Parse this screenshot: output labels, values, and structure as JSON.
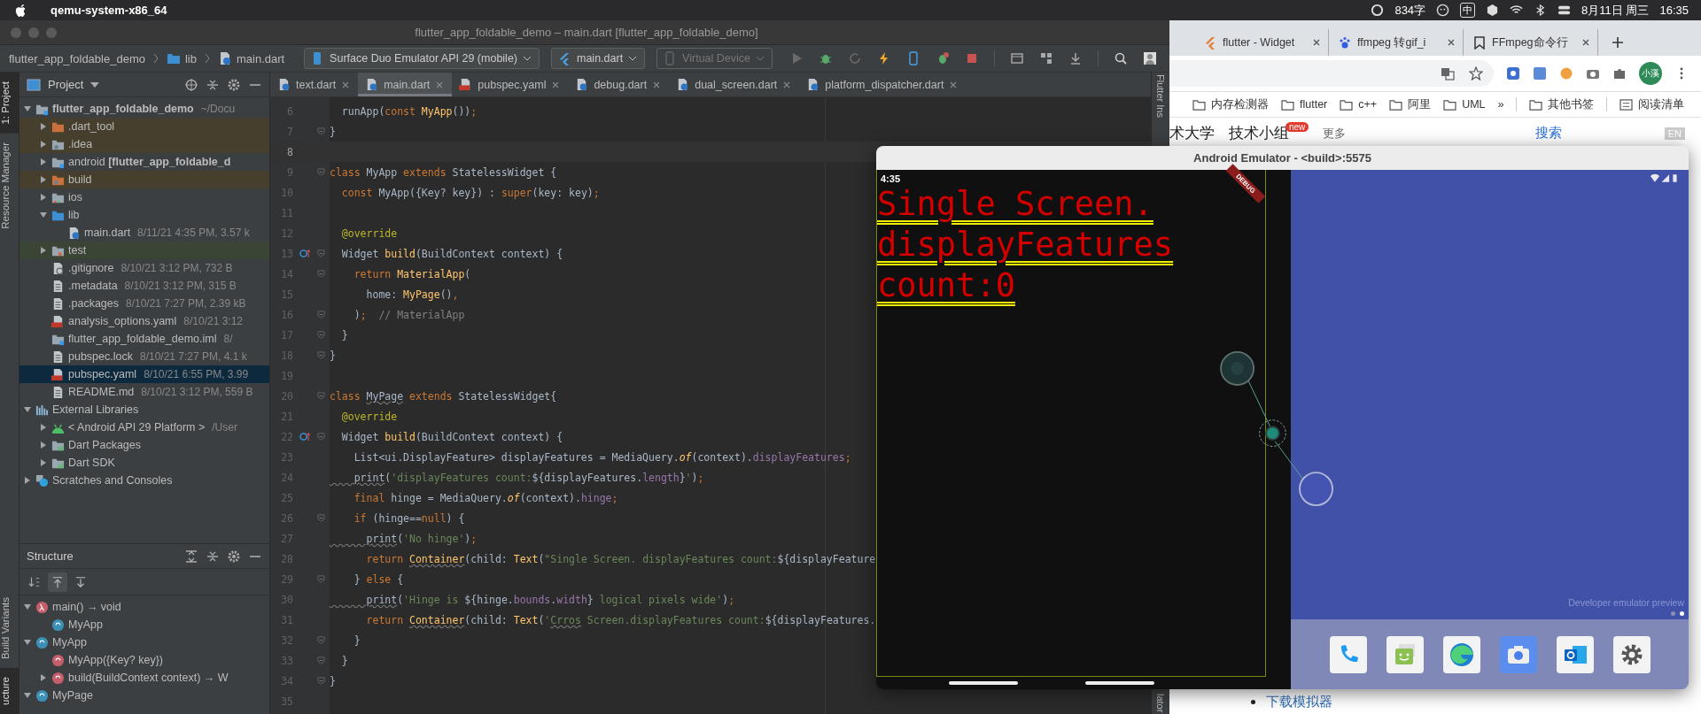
{
  "menubar": {
    "app": "qemu-system-x86_64",
    "input_count": "834字",
    "input_method": "中",
    "date": "8月11日 周三",
    "time": "16:35"
  },
  "ide": {
    "title": "flutter_app_foldable_demo – main.dart [flutter_app_foldable_demo]",
    "breadcrumb": [
      "flutter_app_foldable_demo",
      "lib",
      "main.dart"
    ],
    "device_selector": "Surface Duo Emulator API 29 (mobile)",
    "run_config": "main.dart",
    "target_selector": "Virtual Device",
    "left_strip": [
      {
        "label": "1: Project",
        "selected": true
      },
      {
        "label": "Resource Manager",
        "selected": false
      },
      {
        "label": "Build Variants",
        "selected": false
      },
      {
        "label": "ucture",
        "selected": true
      }
    ],
    "right_strip": [
      "Flutter Ins",
      "lator"
    ],
    "project": {
      "title": "Project",
      "tree": [
        {
          "name": "flutter_app_foldable_demo",
          "detail": "~/Docu",
          "kind": "module-root",
          "expanded": true,
          "selected": false,
          "children": [
            {
              "name": ".dart_tool",
              "kind": "folder-orange",
              "expanded": false,
              "selected": false,
              "color": "#463f2e"
            },
            {
              "name": ".idea",
              "kind": "folder-gear",
              "expanded": false,
              "selected": false,
              "color": "#463f2e"
            },
            {
              "name": "android **[flutter_app_foldable_d**",
              "kind": "module",
              "expanded": false,
              "selected": false
            },
            {
              "name": "build",
              "kind": "folder-orange-gear",
              "expanded": false,
              "selected": false,
              "color": "#463f2e"
            },
            {
              "name": "ios",
              "kind": "folder-ios",
              "expanded": false,
              "selected": false
            },
            {
              "name": "lib",
              "kind": "folder-blue",
              "expanded": true,
              "selected": false,
              "children": [
                {
                  "name": "main.dart",
                  "detail": "8/11/21 4:35 PM, 3.57 k",
                  "kind": "dart",
                  "selected": false
                }
              ]
            },
            {
              "name": "test",
              "kind": "folder-test",
              "expanded": false,
              "selected": false,
              "color": "#3b4536"
            },
            {
              "name": ".gitignore",
              "detail": "8/10/21 3:12 PM, 732 B",
              "kind": "file-ignore",
              "selected": false
            },
            {
              "name": ".metadata",
              "detail": "8/10/21 3:12 PM, 315 B",
              "kind": "file",
              "selected": false
            },
            {
              "name": ".packages",
              "detail": "8/10/21 7:27 PM, 2.39 kB",
              "kind": "file",
              "selected": false
            },
            {
              "name": "analysis_options.yaml",
              "detail": "8/10/21 3:12",
              "kind": "yaml",
              "selected": false
            },
            {
              "name": "flutter_app_foldable_demo.iml",
              "detail": "8/",
              "kind": "module",
              "selected": false
            },
            {
              "name": "pubspec.lock",
              "detail": "8/10/21 7:27 PM, 4.1 k",
              "kind": "file",
              "selected": false
            },
            {
              "name": "pubspec.yaml",
              "detail": "8/10/21 6:55 PM, 3.99",
              "kind": "yaml",
              "selected": true
            },
            {
              "name": "README.md",
              "detail": "8/10/21 3:12 PM, 559 B",
              "kind": "file",
              "selected": false
            }
          ]
        },
        {
          "name": "External Libraries",
          "kind": "libraries",
          "expanded": true,
          "selected": false,
          "children": [
            {
              "name": "< Android API 29 Platform >",
              "detail": "/User",
              "kind": "android",
              "expanded": false,
              "selected": false
            },
            {
              "name": "Dart Packages",
              "kind": "library",
              "expanded": false,
              "selected": false
            },
            {
              "name": "Dart SDK",
              "kind": "library",
              "expanded": false,
              "selected": false
            }
          ]
        },
        {
          "name": "Scratches and Consoles",
          "kind": "scratches",
          "expanded": false,
          "selected": false
        }
      ]
    },
    "structure": {
      "title": "Structure",
      "tools": [
        {
          "kind": "sort",
          "selected": false
        },
        {
          "kind": "up",
          "selected": true
        },
        {
          "kind": "down",
          "selected": false
        }
      ],
      "tree": [
        {
          "name": "main() → void",
          "kind": "function",
          "expanded": true,
          "selected": false,
          "children": [
            {
              "name": "MyApp",
              "kind": "class",
              "selected": false
            }
          ]
        },
        {
          "name": "MyApp",
          "kind": "class",
          "expanded": true,
          "selected": false,
          "children": [
            {
              "name": "MyApp({Key? key})",
              "kind": "method",
              "selected": false
            },
            {
              "name": "build(BuildContext context) → W",
              "kind": "method",
              "expanded": false,
              "selected": false
            }
          ]
        },
        {
          "name": "MyPage",
          "kind": "class",
          "expanded": true,
          "selected": false
        }
      ]
    },
    "tabs": [
      {
        "label": "text.dart",
        "kind": "dart",
        "selected": false
      },
      {
        "label": "main.dart",
        "kind": "dart",
        "selected": true
      },
      {
        "label": "pubspec.yaml",
        "kind": "yaml",
        "selected": false
      },
      {
        "label": "debug.dart",
        "kind": "dart",
        "selected": false
      },
      {
        "label": "dual_screen.dart",
        "kind": "dart",
        "selected": false
      },
      {
        "label": "platform_dispatcher.dart",
        "kind": "dart",
        "selected": false
      }
    ],
    "lines": [
      {
        "number": "6",
        "current": false,
        "fold": false,
        "override": false,
        "tokens": [
          {
            "kind": "plain",
            "text": "  runApp("
          },
          {
            "kind": "keyword",
            "text": "const "
          },
          {
            "kind": "call",
            "text": "MyApp"
          },
          {
            "kind": "plain",
            "text": "())"
          },
          {
            "kind": "keyword",
            "text": ";"
          }
        ]
      },
      {
        "number": "7",
        "current": false,
        "fold": true,
        "override": false,
        "tokens": [
          {
            "kind": "plain",
            "text": "}"
          }
        ]
      },
      {
        "number": "8",
        "current": true,
        "fold": false,
        "override": false
      },
      {
        "number": "9",
        "current": false,
        "fold": true,
        "override": false,
        "tokens": [
          {
            "kind": "keyword",
            "text": "class "
          },
          {
            "kind": "plain",
            "text": "MyApp "
          },
          {
            "kind": "keyword",
            "text": "extends "
          },
          {
            "kind": "plain",
            "text": "StatelessWidget {"
          }
        ]
      },
      {
        "number": "10",
        "current": false,
        "fold": false,
        "override": false,
        "tokens": [
          {
            "kind": "keyword",
            "text": "  const "
          },
          {
            "kind": "plain",
            "text": "MyApp({Key? key}) : "
          },
          {
            "kind": "keyword",
            "text": "super"
          },
          {
            "kind": "plain",
            "text": "(key: key)"
          },
          {
            "kind": "keyword",
            "text": ";"
          }
        ]
      },
      {
        "number": "11",
        "current": false,
        "fold": false,
        "override": false
      },
      {
        "number": "12",
        "current": false,
        "fold": false,
        "override": false,
        "tokens": [
          {
            "kind": "annotation",
            "text": "  @override"
          }
        ]
      },
      {
        "number": "13",
        "current": false,
        "fold": true,
        "override": true,
        "tokens": [
          {
            "kind": "plain",
            "text": "  Widget "
          },
          {
            "kind": "call",
            "text": "build"
          },
          {
            "kind": "plain",
            "text": "(BuildContext context) {"
          }
        ]
      },
      {
        "number": "14",
        "current": false,
        "fold": true,
        "override": false,
        "tokens": [
          {
            "kind": "keyword",
            "text": "    return "
          },
          {
            "kind": "call",
            "text": "MaterialApp"
          },
          {
            "kind": "plain",
            "text": "("
          }
        ]
      },
      {
        "number": "15",
        "current": false,
        "fold": false,
        "override": false,
        "tokens": [
          {
            "kind": "plain",
            "text": "      home: "
          },
          {
            "kind": "call",
            "text": "MyPage"
          },
          {
            "kind": "plain",
            "text": "()"
          },
          {
            "kind": "keyword",
            "text": ","
          }
        ]
      },
      {
        "number": "16",
        "current": false,
        "fold": true,
        "override": false,
        "tokens": [
          {
            "kind": "plain",
            "text": "    )"
          },
          {
            "kind": "keyword",
            "text": ";"
          },
          {
            "kind": "comment",
            "text": "  // MaterialApp"
          }
        ]
      },
      {
        "number": "17",
        "current": false,
        "fold": true,
        "override": false,
        "tokens": [
          {
            "kind": "plain",
            "text": "  }"
          }
        ]
      },
      {
        "number": "18",
        "current": false,
        "fold": true,
        "override": false,
        "tokens": [
          {
            "kind": "plain",
            "text": "}"
          }
        ]
      },
      {
        "number": "19",
        "current": false,
        "fold": false,
        "override": false
      },
      {
        "number": "20",
        "current": false,
        "fold": true,
        "override": false,
        "tokens": [
          {
            "kind": "keyword",
            "text": "class "
          },
          {
            "kind": "warn",
            "text": "MyPage"
          },
          {
            "kind": "keyword",
            "text": " extends "
          },
          {
            "kind": "plain",
            "text": "StatelessWidget{"
          }
        ]
      },
      {
        "number": "21",
        "current": false,
        "fold": false,
        "override": false,
        "tokens": [
          {
            "kind": "annotation",
            "text": "  @override"
          }
        ]
      },
      {
        "number": "22",
        "current": false,
        "fold": true,
        "override": true,
        "tokens": [
          {
            "kind": "plain",
            "text": "  Widget "
          },
          {
            "kind": "call",
            "text": "build"
          },
          {
            "kind": "plain",
            "text": "(BuildContext context) {"
          }
        ]
      },
      {
        "number": "23",
        "current": false,
        "fold": false,
        "override": false,
        "tokens": [
          {
            "kind": "plain",
            "text": "    List<ui.DisplayFeature> displayFeatures = MediaQuery."
          },
          {
            "kind": "static",
            "text": "of"
          },
          {
            "kind": "plain",
            "text": "(context)."
          },
          {
            "kind": "field",
            "text": "displayFeatures"
          },
          {
            "kind": "keyword",
            "text": ";"
          }
        ]
      },
      {
        "number": "24",
        "current": false,
        "fold": false,
        "override": false,
        "tokens": [
          {
            "kind": "warn",
            "text": "    print"
          },
          {
            "kind": "plain",
            "text": "("
          },
          {
            "kind": "string",
            "text": "'displayFeatures count:"
          },
          {
            "kind": "plain",
            "text": "${displayFeatures."
          },
          {
            "kind": "field",
            "text": "length"
          },
          {
            "kind": "plain",
            "text": "}"
          },
          {
            "kind": "string",
            "text": "'"
          },
          {
            "kind": "plain",
            "text": ")"
          },
          {
            "kind": "keyword",
            "text": ";"
          }
        ]
      },
      {
        "number": "25",
        "current": false,
        "fold": false,
        "override": false,
        "tokens": [
          {
            "kind": "keyword",
            "text": "    final "
          },
          {
            "kind": "plain",
            "text": "hinge = MediaQuery."
          },
          {
            "kind": "static",
            "text": "of"
          },
          {
            "kind": "plain",
            "text": "(context)."
          },
          {
            "kind": "field",
            "text": "hinge"
          },
          {
            "kind": "keyword",
            "text": ";"
          }
        ]
      },
      {
        "number": "26",
        "current": false,
        "fold": true,
        "override": false,
        "tokens": [
          {
            "kind": "keyword",
            "text": "    if "
          },
          {
            "kind": "plain",
            "text": "(hinge=="
          },
          {
            "kind": "keyword",
            "text": "null"
          },
          {
            "kind": "plain",
            "text": ") {"
          }
        ]
      },
      {
        "number": "27",
        "current": false,
        "fold": false,
        "override": false,
        "tokens": [
          {
            "kind": "warn",
            "text": "      print"
          },
          {
            "kind": "plain",
            "text": "("
          },
          {
            "kind": "string",
            "text": "'No hinge'"
          },
          {
            "kind": "plain",
            "text": ")"
          },
          {
            "kind": "keyword",
            "text": ";"
          }
        ]
      },
      {
        "number": "28",
        "current": false,
        "fold": false,
        "override": false,
        "tokens": [
          {
            "kind": "keyword",
            "text": "      return "
          },
          {
            "kind": "warn-call",
            "text": "Container"
          },
          {
            "kind": "plain",
            "text": "(child: "
          },
          {
            "kind": "call",
            "text": "Text"
          },
          {
            "kind": "plain",
            "text": "("
          },
          {
            "kind": "string",
            "text": "\"Single Screen. displayFeatures count:"
          },
          {
            "kind": "plain",
            "text": "${displayFeature"
          }
        ]
      },
      {
        "number": "29",
        "current": false,
        "fold": true,
        "override": false,
        "tokens": [
          {
            "kind": "plain",
            "text": "    } "
          },
          {
            "kind": "keyword",
            "text": "else "
          },
          {
            "kind": "plain",
            "text": "{"
          }
        ]
      },
      {
        "number": "30",
        "current": false,
        "fold": false,
        "override": false,
        "tokens": [
          {
            "kind": "warn",
            "text": "      print"
          },
          {
            "kind": "plain",
            "text": "("
          },
          {
            "kind": "string",
            "text": "'Hinge is "
          },
          {
            "kind": "plain",
            "text": "${hinge."
          },
          {
            "kind": "field",
            "text": "bounds"
          },
          {
            "kind": "plain",
            "text": "."
          },
          {
            "kind": "field",
            "text": "width"
          },
          {
            "kind": "plain",
            "text": "}"
          },
          {
            "kind": "string",
            "text": " logical pixels wide'"
          },
          {
            "kind": "plain",
            "text": ")"
          },
          {
            "kind": "keyword",
            "text": ";"
          }
        ]
      },
      {
        "number": "31",
        "current": false,
        "fold": false,
        "override": false,
        "tokens": [
          {
            "kind": "keyword",
            "text": "      return "
          },
          {
            "kind": "warn-call",
            "text": "Container"
          },
          {
            "kind": "plain",
            "text": "(child: "
          },
          {
            "kind": "call",
            "text": "Text"
          },
          {
            "kind": "plain",
            "text": "("
          },
          {
            "kind": "string",
            "text": "'"
          },
          {
            "kind": "warn-string",
            "text": "Crros"
          },
          {
            "kind": "string",
            "text": " Screen.displayFeatures count:"
          },
          {
            "kind": "plain",
            "text": "${displayFeatures."
          }
        ]
      },
      {
        "number": "32",
        "current": false,
        "fold": true,
        "override": false,
        "tokens": [
          {
            "kind": "plain",
            "text": "    }"
          }
        ]
      },
      {
        "number": "33",
        "current": false,
        "fold": true,
        "override": false,
        "tokens": [
          {
            "kind": "plain",
            "text": "  }"
          }
        ]
      },
      {
        "number": "34",
        "current": false,
        "fold": true,
        "override": false,
        "tokens": [
          {
            "kind": "plain",
            "text": "}"
          }
        ]
      },
      {
        "number": "35",
        "current": false,
        "fold": false,
        "override": false
      }
    ]
  },
  "browser": {
    "tabs": [
      {
        "label": "flutter - Widget",
        "kind": "flutter",
        "selected": false
      },
      {
        "label": "ffmpeg 转gif_i",
        "kind": "paw",
        "selected": false
      },
      {
        "label": "FFmpeg命令行",
        "kind": "bookmark",
        "selected": false
      }
    ],
    "avatar": "小溪",
    "bookmarks": [
      "内存检测器",
      "flutter",
      "c++",
      "阿里",
      "UML"
    ],
    "overflow": "»",
    "other_bookmarks": "其他书签",
    "reading_list": "阅读清单",
    "nav": [
      "术大学",
      "技术小组"
    ],
    "badge": "new",
    "more": "更多",
    "search": "搜索",
    "lang": "EN",
    "list_item": "下载模拟器"
  },
  "emulator": {
    "title": "Android Emulator - <build>:5575",
    "status_time": "4:35",
    "message": "Single Screen. displayFeatures count:0",
    "banner": "DEBUG",
    "caption": "Developer emulator preview",
    "pages": [
      {
        "selected": false
      },
      {
        "selected": true
      }
    ],
    "dock": [
      {
        "kind": "phone"
      },
      {
        "kind": "messages"
      },
      {
        "kind": "browser"
      },
      {
        "kind": "camera"
      },
      {
        "kind": "mail"
      },
      {
        "kind": "settings"
      }
    ]
  }
}
